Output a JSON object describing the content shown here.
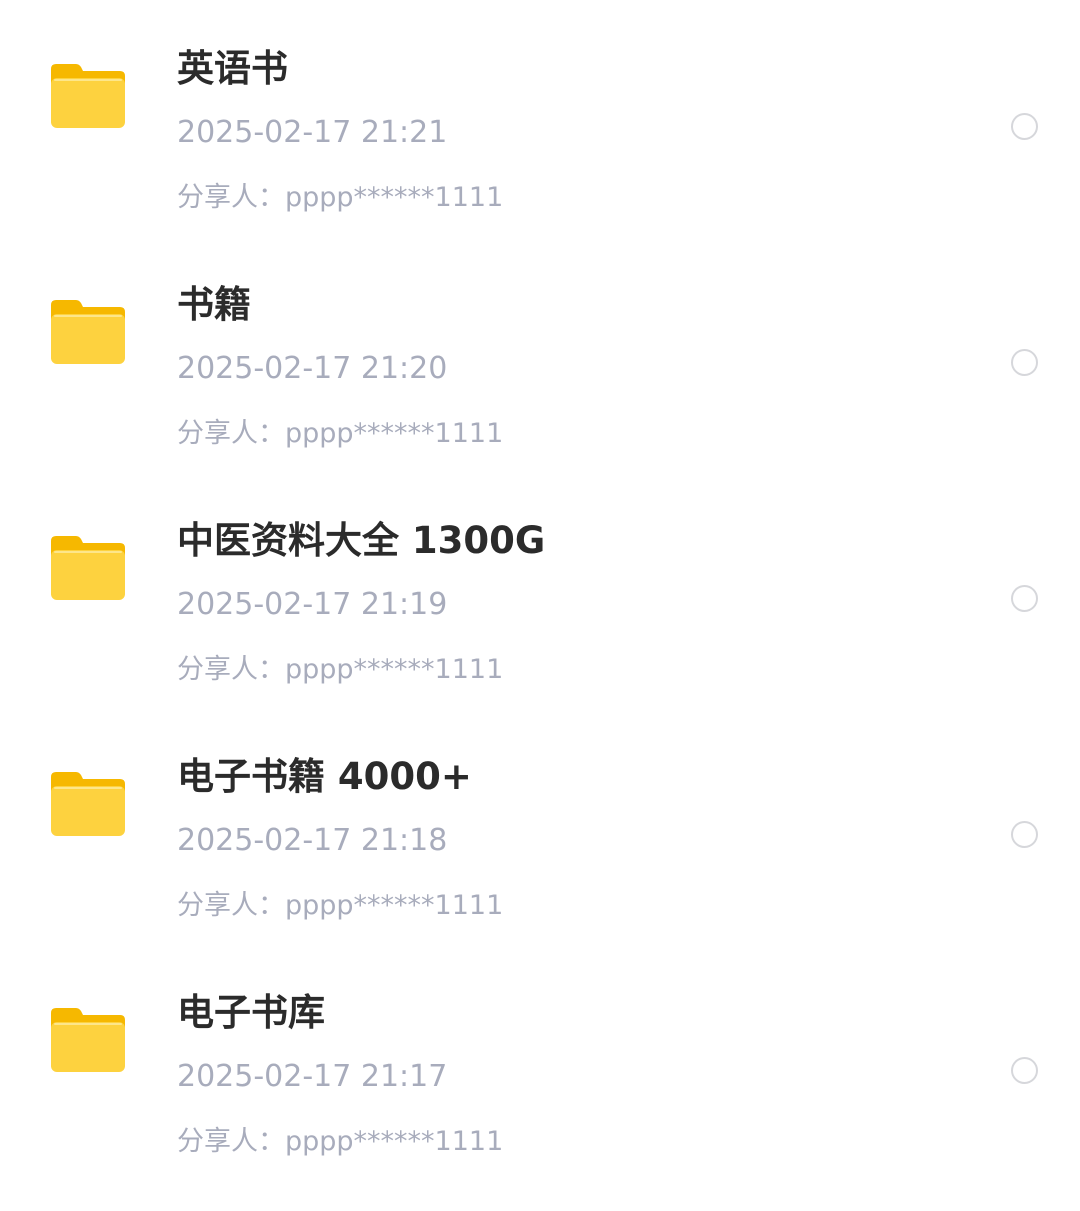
{
  "files": [
    {
      "name": "英语书",
      "time": "2025-02-17 21:21",
      "sharer": "分享人：pppp******1111",
      "icon": "folder-icon"
    },
    {
      "name": "书籍",
      "time": "2025-02-17 21:20",
      "sharer": "分享人：pppp******1111",
      "icon": "folder-icon"
    },
    {
      "name": "中医资料大全 1300G",
      "time": "2025-02-17 21:19",
      "sharer": "分享人：pppp******1111",
      "icon": "folder-icon"
    },
    {
      "name": "电子书籍 4000+",
      "time": "2025-02-17 21:18",
      "sharer": "分享人：pppp******1111",
      "icon": "folder-icon"
    },
    {
      "name": "电子书库",
      "time": "2025-02-17 21:17",
      "sharer": "分享人：pppp******1111",
      "icon": "folder-icon"
    }
  ],
  "colors": {
    "folder_front": "#fdd23f",
    "folder_back": "#f6b800",
    "title_text": "#2b2b2b",
    "meta_text": "#a8acbc",
    "radio_border": "#d6d7db"
  }
}
